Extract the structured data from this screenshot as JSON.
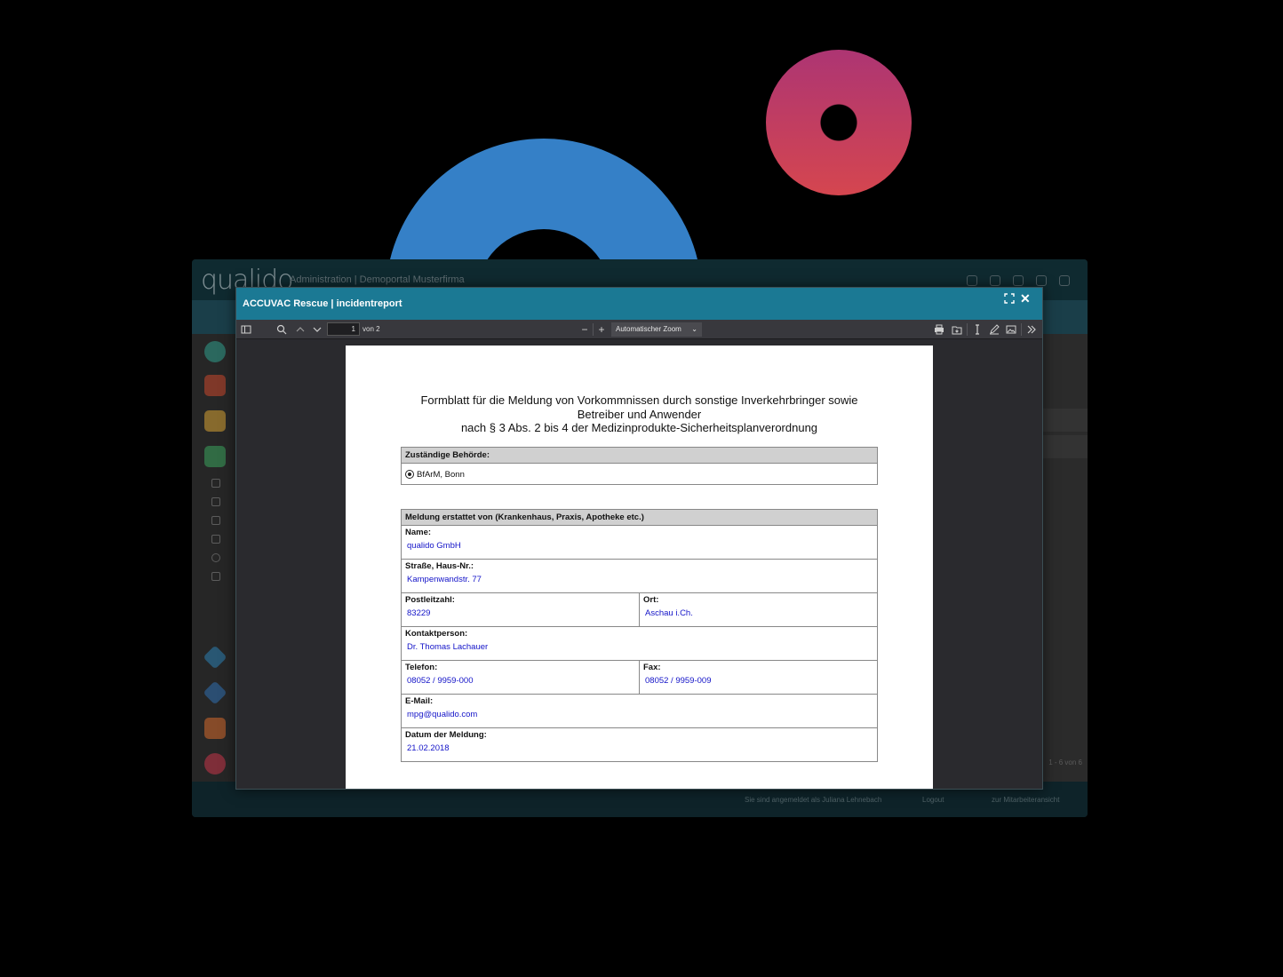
{
  "app": {
    "logo": "qualido",
    "subtitle": "Administration | Demoportal Musterfirma",
    "pager": "1 - 6 von 6",
    "footer_logged_in": "Sie sind angemeldet als Juliana Lehnebach",
    "footer_logout": "Logout",
    "footer_employee_view": "zur Mitarbeiteransicht"
  },
  "modal": {
    "title": "ACCUVAC Rescue | incidentreport",
    "maximize_icon": "maximize-icon",
    "close_glyph": "✕"
  },
  "toolbar": {
    "page_number": "1",
    "page_of": "von 2",
    "zoom_label": "Automatischer Zoom",
    "zoom_out": "−",
    "zoom_in": "+"
  },
  "document": {
    "title_lines": [
      "Formblatt für die Meldung von Vorkommnissen  durch sonstige Inverkehrbringer sowie",
      "Betreiber und Anwender",
      "nach § 3 Abs. 2 bis 4 der Medizinprodukte-Sicherheitsplanverordnung"
    ],
    "authority": {
      "header": "Zuständige Behörde:",
      "value": "BfArM, Bonn"
    },
    "report": {
      "header": "Meldung erstattet von (Krankenhaus, Praxis, Apotheke etc.)",
      "name_label": "Name:",
      "name_value": "qualido GmbH",
      "street_label": "Straße, Haus-Nr.:",
      "street_value": "Kampenwandstr. 77",
      "zip_label": "Postleitzahl:",
      "zip_value": "83229",
      "city_label": "Ort:",
      "city_value": "Aschau i.Ch.",
      "contact_label": "Kontaktperson:",
      "contact_value": "Dr. Thomas Lachauer",
      "phone_label": "Telefon:",
      "phone_value": "08052 / 9959-000",
      "fax_label": "Fax:",
      "fax_value": "08052 / 9959-009",
      "email_label": "E-Mail:",
      "email_value": "mpg@qualido.com",
      "date_label": "Datum der Meldung:",
      "date_value": "21.02.2018"
    }
  },
  "colors": {
    "ring_blue": "#3580c7",
    "ring_pink_top": "#ad3573",
    "ring_pink_bottom": "#d5464f",
    "modal_title_bar": "#1b7994",
    "value_text": "#1313c8"
  }
}
